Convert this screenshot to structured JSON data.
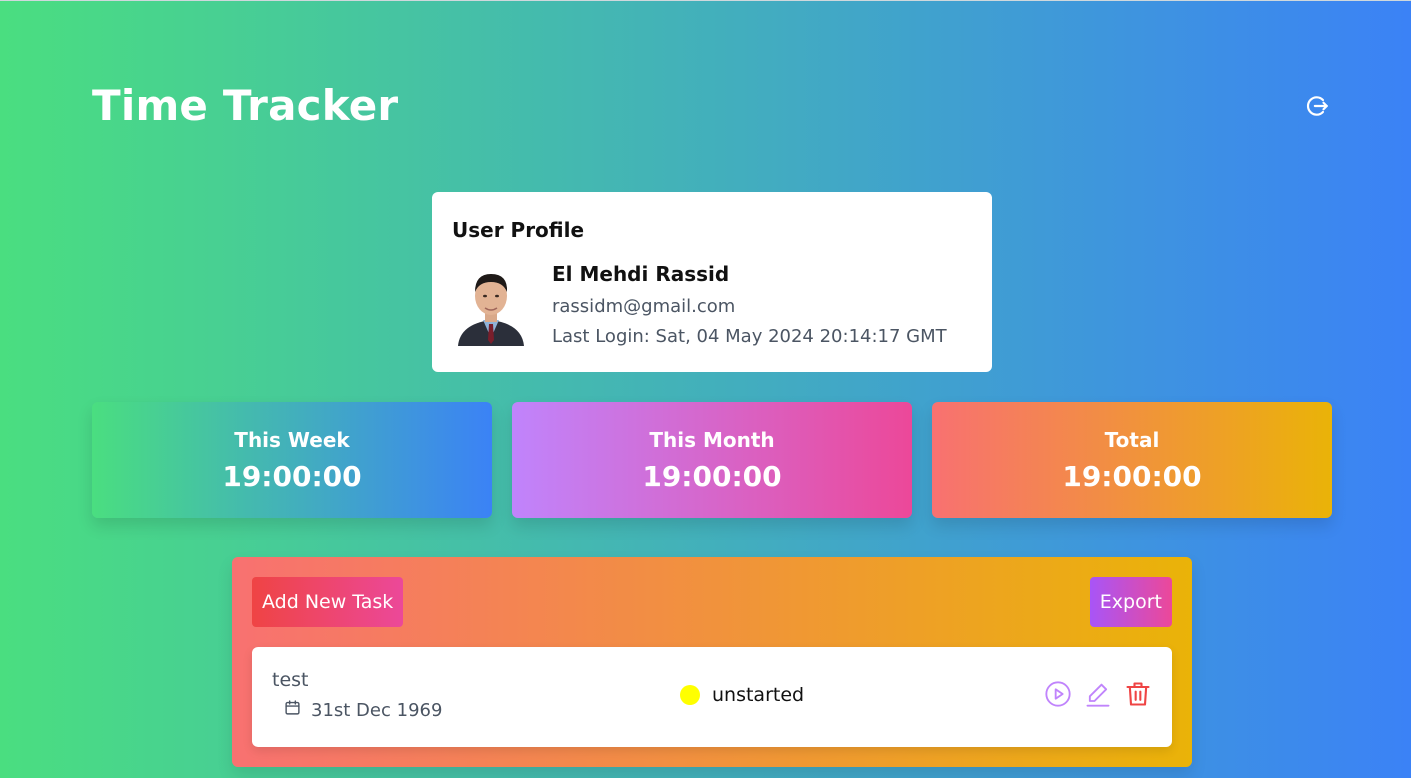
{
  "app": {
    "title": "Time Tracker",
    "logout_icon": "logout-icon"
  },
  "profile": {
    "heading": "User Profile",
    "name": "El Mehdi Rassid",
    "email": "rassidm@gmail.com",
    "last_login": "Last Login: Sat, 04 May 2024 20:14:17 GMT"
  },
  "stats": {
    "week": {
      "label": "This Week",
      "value": "19:00:00"
    },
    "month": {
      "label": "This Month",
      "value": "19:00:00"
    },
    "total": {
      "label": "Total",
      "value": "19:00:00"
    }
  },
  "tasks": {
    "add_label": "Add New Task",
    "export_label": "Export",
    "items": [
      {
        "name": "test",
        "date": "31st Dec 1969",
        "status": "unstarted",
        "status_color": "#ffff00"
      }
    ]
  },
  "colors": {
    "background_start": "#4ade80",
    "background_end": "#3b82f6",
    "action_purple": "#c084fc",
    "delete_red": "#ef4444"
  }
}
